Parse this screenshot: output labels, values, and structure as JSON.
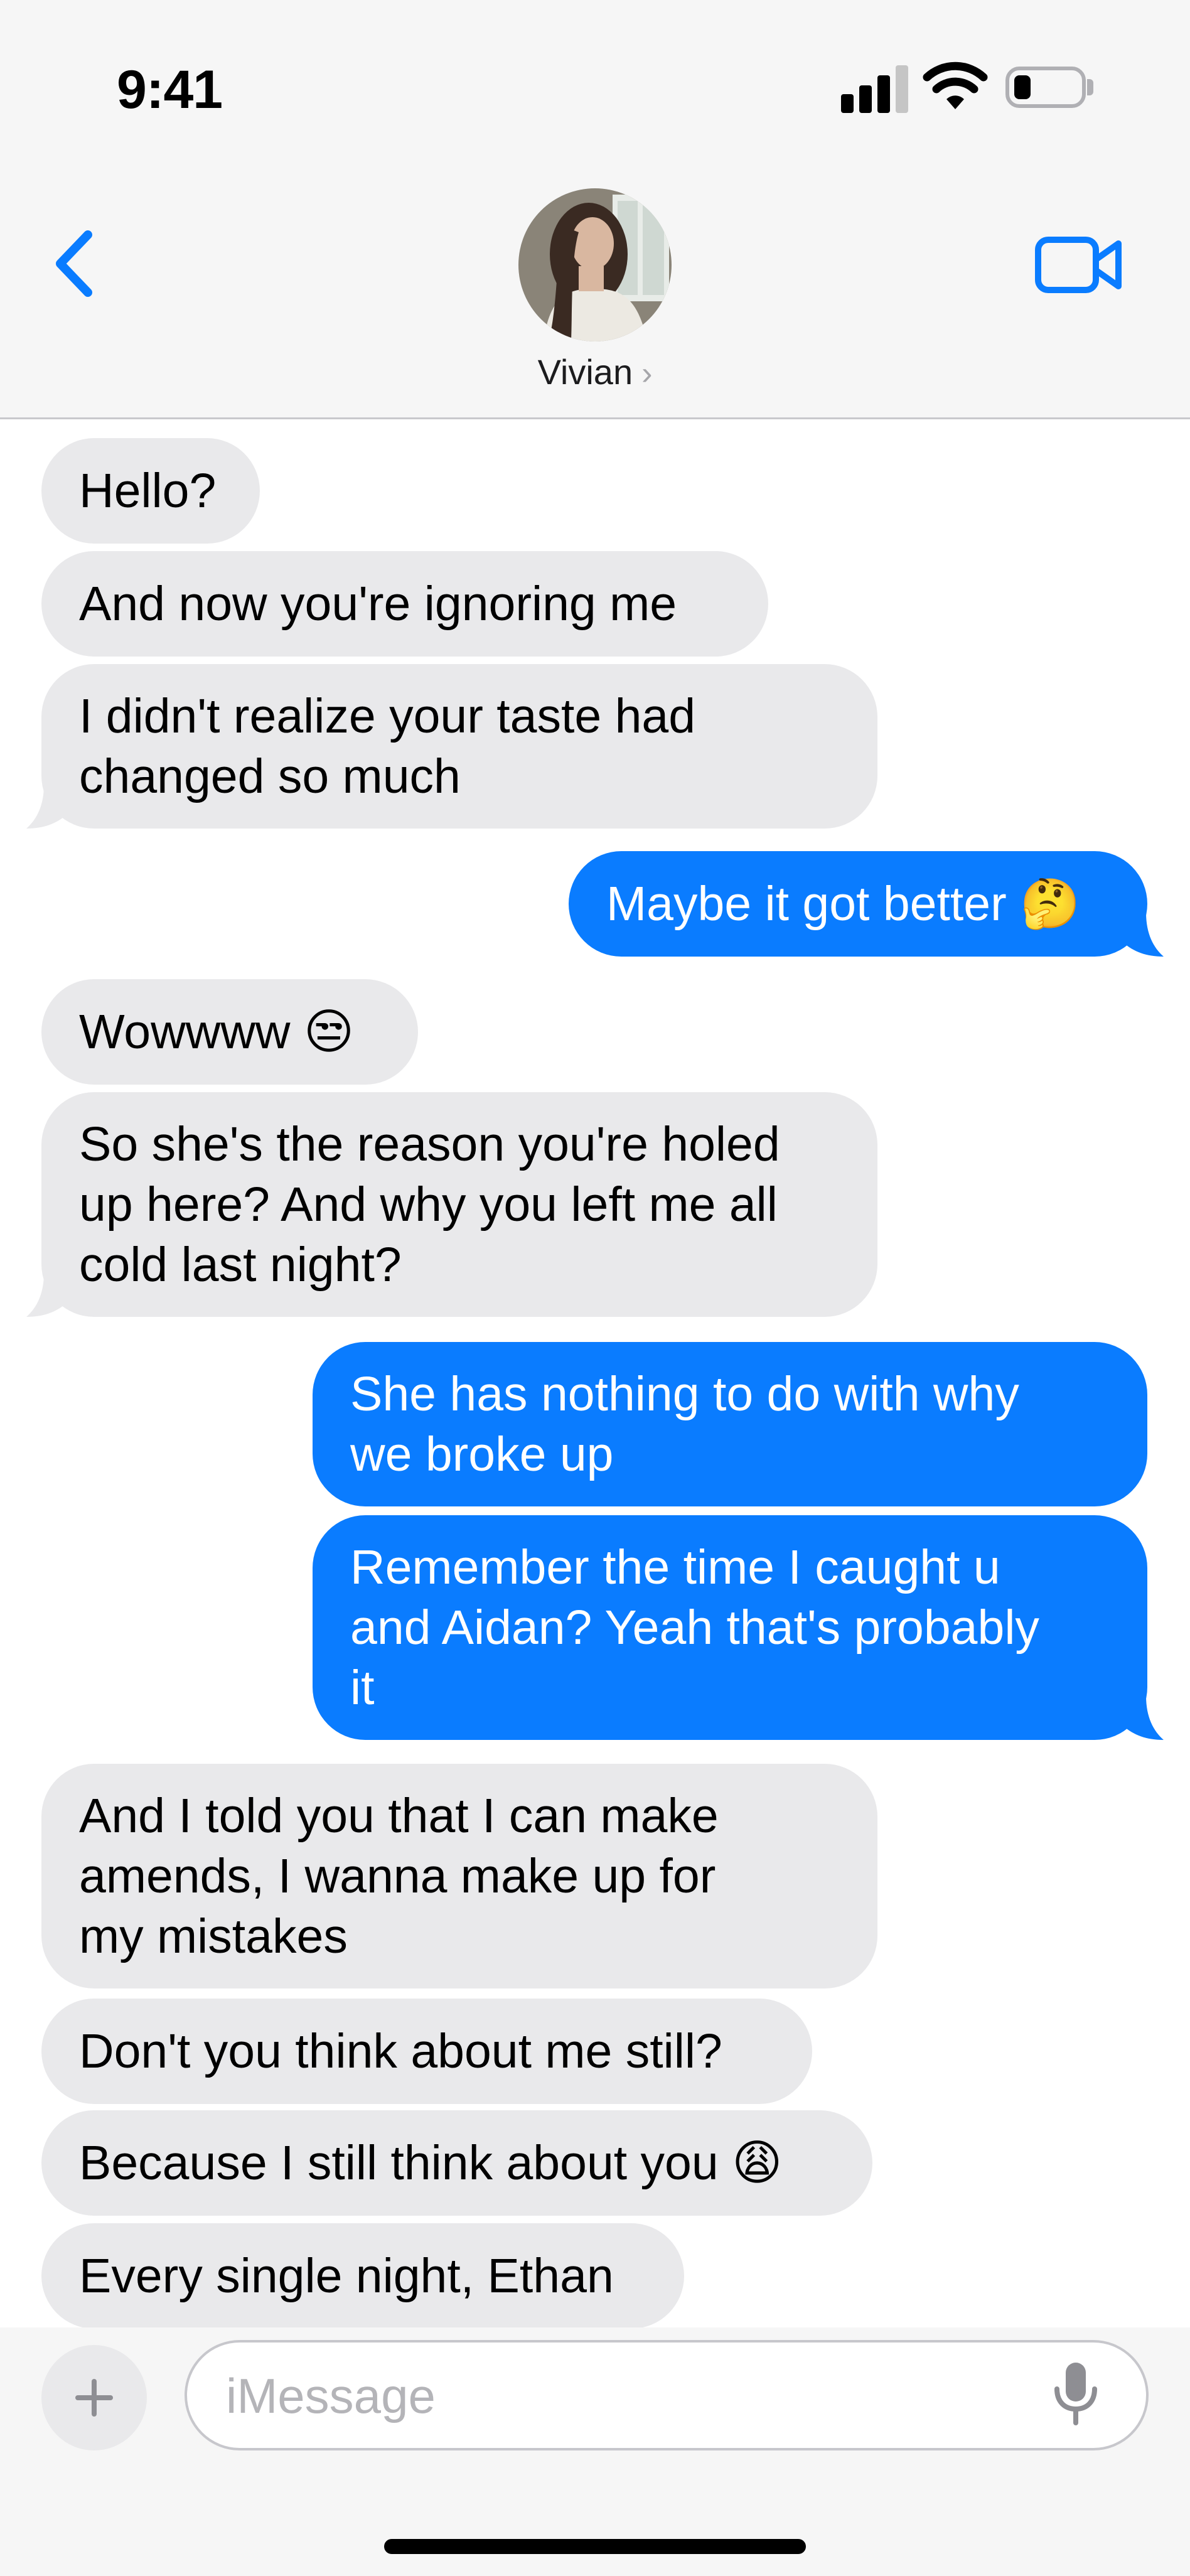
{
  "status_bar": {
    "time": "9:41"
  },
  "contact": {
    "name": "Vivian",
    "chevron": "›"
  },
  "messages": [
    {
      "from": "them",
      "text": "Hello?"
    },
    {
      "from": "them",
      "text": "And now you're ignoring me"
    },
    {
      "from": "them",
      "text": "I didn't realize your taste had\nchanged so much"
    },
    {
      "from": "me",
      "text": "Maybe it got better 🤔"
    },
    {
      "from": "them",
      "text": "Wowwww 😒"
    },
    {
      "from": "them",
      "text": "So she's the reason you're holed\nup here? And why you left me all\ncold last night?"
    },
    {
      "from": "me",
      "text": "She has nothing to do with why\nwe broke up"
    },
    {
      "from": "me",
      "text": "Remember the time I caught u\nand Aidan? Yeah that's probably\nit"
    },
    {
      "from": "them",
      "text": "And I told you that I can make\namends, I wanna make up for\nmy mistakes"
    },
    {
      "from": "them",
      "text": "Don't you think about me still?"
    },
    {
      "from": "them",
      "text": "Because I still think about you 😩"
    },
    {
      "from": "them",
      "text": "Every single night, Ethan"
    }
  ],
  "composer": {
    "placeholder": "iMessage"
  },
  "icons": {
    "back": "chevron-left-icon",
    "video": "video-camera-icon",
    "add": "plus-icon",
    "mic": "microphone-icon"
  },
  "colors": {
    "accent": "#0a7cff",
    "incoming_bubble": "#e9e9eb",
    "header_bg": "#f6f6f6"
  }
}
